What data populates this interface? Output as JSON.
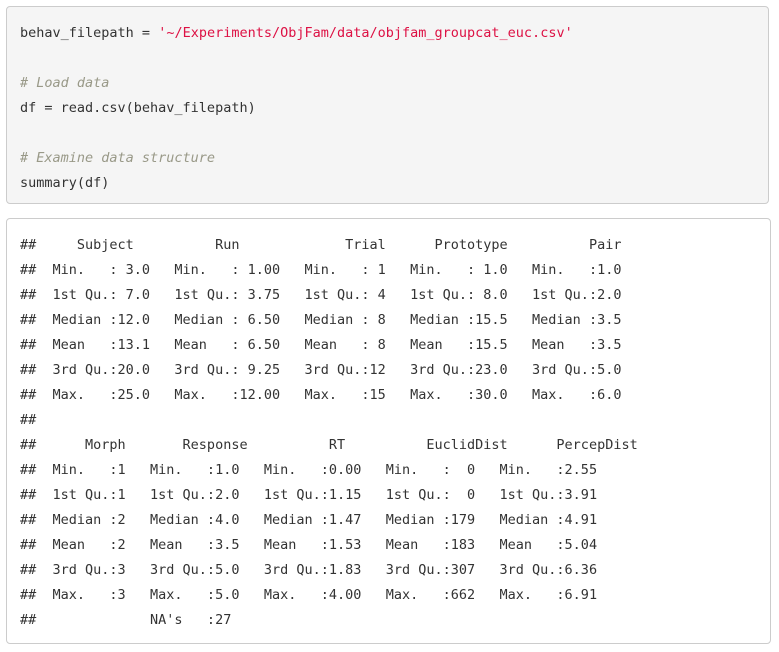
{
  "code": {
    "line1": {
      "var": "behav_filepath",
      "op": " = ",
      "path": "'~/Experiments/ObjFam/data/objfam_groupcat_euc.csv'"
    },
    "comment1": "# Load data",
    "line2": "df = read.csv(behav_filepath)",
    "comment2": "# Examine data structure",
    "line3": "summary(df)"
  },
  "output": {
    "lines": [
      "##     Subject          Run             Trial      Prototype          Pair   ",
      "##  Min.   : 3.0   Min.   : 1.00   Min.   : 1   Min.   : 1.0   Min.   :1.0  ",
      "##  1st Qu.: 7.0   1st Qu.: 3.75   1st Qu.: 4   1st Qu.: 8.0   1st Qu.:2.0  ",
      "##  Median :12.0   Median : 6.50   Median : 8   Median :15.5   Median :3.5  ",
      "##  Mean   :13.1   Mean   : 6.50   Mean   : 8   Mean   :15.5   Mean   :3.5  ",
      "##  3rd Qu.:20.0   3rd Qu.: 9.25   3rd Qu.:12   3rd Qu.:23.0   3rd Qu.:5.0  ",
      "##  Max.   :25.0   Max.   :12.00   Max.   :15   Max.   :30.0   Max.   :6.0  ",
      "##                                                                         ",
      "##      Morph       Response          RT          EuclidDist      PercepDist   ",
      "##  Min.   :1   Min.   :1.0   Min.   :0.00   Min.   :  0   Min.   :2.55  ",
      "##  1st Qu.:1   1st Qu.:2.0   1st Qu.:1.15   1st Qu.:  0   1st Qu.:3.91  ",
      "##  Median :2   Median :4.0   Median :1.47   Median :179   Median :4.91  ",
      "##  Mean   :2   Mean   :3.5   Mean   :1.53   Mean   :183   Mean   :5.04  ",
      "##  3rd Qu.:3   3rd Qu.:5.0   3rd Qu.:1.83   3rd Qu.:307   3rd Qu.:6.36  ",
      "##  Max.   :3   Max.   :5.0   Max.   :4.00   Max.   :662   Max.   :6.91  ",
      "##              NA's   :27                                                "
    ]
  }
}
